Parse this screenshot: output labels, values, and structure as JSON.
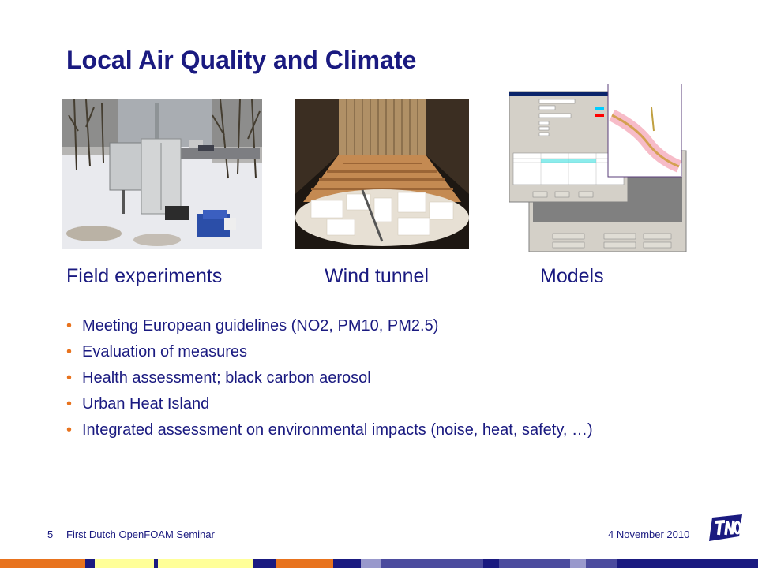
{
  "slide": {
    "title": "Local Air Quality and Climate",
    "captions": {
      "field": "Field experiments",
      "wind": "Wind tunnel",
      "models": "Models"
    },
    "bullets": [
      "Meeting European guidelines (NO2, PM10, PM2.5)",
      "Evaluation of measures",
      "Health assessment;  black carbon aerosol",
      "Urban Heat Island",
      "Integrated assessment on environmental impacts (noise, heat, safety, …)"
    ],
    "bullet_color": "#e8731e",
    "text_color": "#1a1a80"
  },
  "footer": {
    "page_number": "5",
    "event": "First Dutch OpenFOAM Seminar",
    "date": "4 November 2010",
    "logo_icon": "tno-logo-icon"
  },
  "stripe_colors": [
    "#e8731e",
    "#1a1a80",
    "#ffff99",
    "#1a1a80",
    "#ffff99",
    "#1a1a80",
    "#e8731e",
    "#1a1a80",
    "#9999cc",
    "#4b4b9e"
  ]
}
